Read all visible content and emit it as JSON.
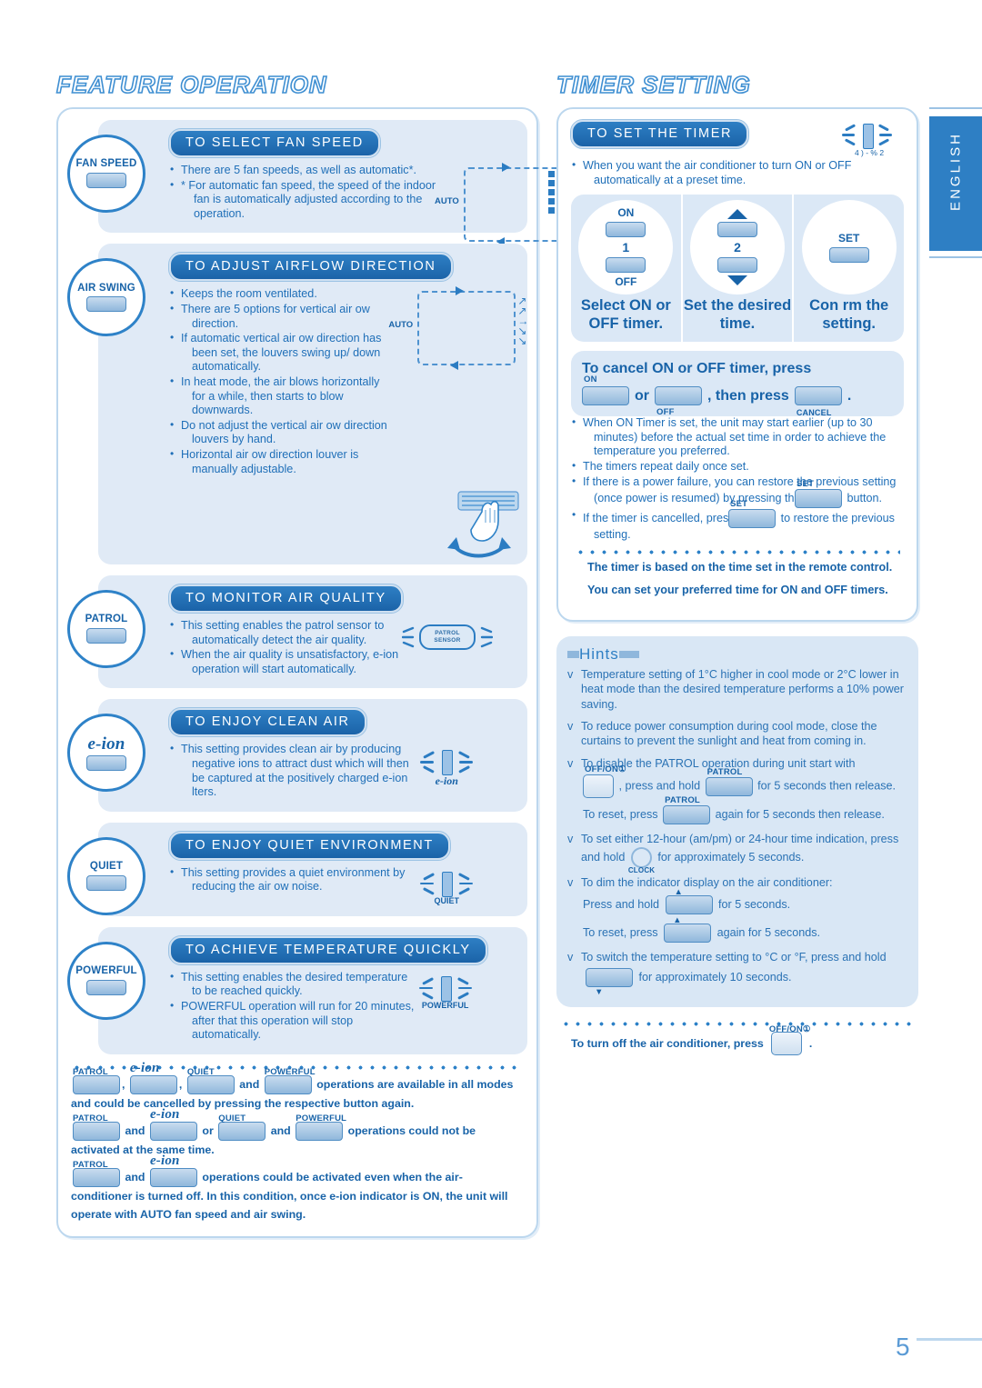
{
  "page": {
    "number": "5",
    "language_tab": "ENGLISH"
  },
  "left": {
    "title": "FEATURE OPERATION",
    "sections": [
      {
        "button_label": "FAN SPEED",
        "heading": "TO SELECT FAN SPEED",
        "bullets": [
          "There are 5 fan speeds, as well as automatic*.",
          "*  For automatic fan speed, the speed of the indoor fan is automatically adjusted according to the operation."
        ],
        "diagram_label": "AUTO"
      },
      {
        "button_label": "AIR SWING",
        "heading": "TO ADJUST AIRFLOW DIRECTION",
        "bullets": [
          "Keeps the room ventilated.",
          "There are 5 options for vertical air ow direction.",
          "If automatic vertical air ow direction has been set, the louvers swing up/ down automatically.",
          "In heat mode, the air blows horizontally for a while, then starts to blow downwards.",
          "Do not adjust the vertical air ow direction louvers by hand.",
          "Horizontal air ow direction louver is manually adjustable."
        ],
        "diagram_label": "AUTO"
      },
      {
        "button_label": "PATROL",
        "heading": "TO MONITOR AIR QUALITY",
        "bullets": [
          "This setting enables the patrol sensor to automatically detect the air quality.",
          "When the air quality is unsatisfactory, e-ion operation will start automatically."
        ],
        "sensor_label_line1": "PATROL",
        "sensor_label_line2": "SENSOR"
      },
      {
        "button_label": "e-ion",
        "heading": "TO ENJOY CLEAN AIR",
        "bullets": [
          "This setting provides clean air by producing negative ions to attract dust which will then be captured at the positively charged e-ion  lters."
        ],
        "indicator_label": "e-ion"
      },
      {
        "button_label": "QUIET",
        "heading": "TO ENJOY QUIET ENVIRONMENT",
        "bullets": [
          "This setting provides a quiet environment by reducing the air ow noise."
        ],
        "indicator_label": "QUIET"
      },
      {
        "button_label": "POWERFUL",
        "heading": "TO ACHIEVE TEMPERATURE QUICKLY",
        "bullets": [
          "This setting enables the desired temperature to be reached quickly.",
          "POWERFUL operation will run for 20 minutes, after that this operation will stop automatically."
        ],
        "indicator_label": "POWERFUL"
      }
    ],
    "notes": {
      "note1_tags": [
        "PATROL",
        "e-ion",
        "QUIET",
        "POWERFUL"
      ],
      "note1_conj": "and",
      "note1_text": "operations are available in all modes and could be cancelled by pressing the respective button again.",
      "note2_tags": [
        "PATROL",
        "e-ion",
        "QUIET",
        "POWERFUL"
      ],
      "note2_joiner1": "and",
      "note2_joiner2": "or",
      "note2_joiner3": "and",
      "note2_text": "operations could not be activated at the same time.",
      "note3_tags": [
        "PATROL",
        "e-ion"
      ],
      "note3_joiner": "and",
      "note3_text": "operations could be activated even when the air-conditioner is turned off. In this condition, once e-ion indicator is ON, the unit will operate with AUTO fan speed and air swing."
    }
  },
  "right": {
    "title": "TIMER SETTING",
    "timer": {
      "heading": "TO SET THE TIMER",
      "indicator_caption": "4 ) - % 2",
      "intro_bullet": "When you want the air conditioner to turn ON or OFF automatically at a preset time.",
      "steps": [
        {
          "num": "1",
          "top_label": "ON",
          "bottom_label": "OFF",
          "caption": "Select ON or OFF timer."
        },
        {
          "num": "2",
          "top_label": "",
          "bottom_label": "",
          "caption": "Set the desired time."
        },
        {
          "num": "",
          "top_label": "SET",
          "bottom_label": "",
          "caption": "Con rm the setting."
        }
      ],
      "cancel_line1": "To cancel ON or OFF timer, press",
      "cancel_on": "ON",
      "cancel_or": "or",
      "cancel_off": "OFF",
      "cancel_then": ", then press",
      "cancel_btn_label": "CANCEL",
      "cancel_period": ".",
      "bullets": [
        "When ON Timer is set, the unit may start earlier (up to 30 minutes) before the actual set time in order to achieve the temperature you preferred.",
        "The timers repeat daily once set."
      ],
      "bullet_power_a": "If there is a power failure, you can restore the previous setting (once power is resumed) by pressing the",
      "bullet_power_btn": "SET",
      "bullet_power_b": "button.",
      "bullet_cancel_a": "If the timer is cancelled, press",
      "bullet_cancel_btn": "SET",
      "bullet_cancel_b": "to restore the previous setting.",
      "note1": "The timer is based on the time set in the remote control.",
      "note2": "You can set your preferred time for ON and OFF timers."
    },
    "hints": {
      "title": "Hints",
      "items": [
        {
          "text": "Temperature setting of 1°C higher in cool mode or 2°C lower in heat mode than the desired temperature performs a 10% power saving."
        },
        {
          "text": "To reduce power consumption during cool mode, close the curtains to prevent the sunlight and heat from coming in."
        },
        {
          "text": "To disable the PATROL operation during unit start with",
          "btn1_label": "OFF/ON",
          "mid1": ", press and hold",
          "btn2_label": "PATROL",
          "mid2": "for 5 seconds then release.",
          "line2_a": "To reset, press",
          "line2_btn": "PATROL",
          "line2_b": "again for 5 seconds then release."
        },
        {
          "text": "To set either 12-hour (am/pm) or 24-hour time indication, press and hold",
          "btn_label": "CLOCK",
          "tail": "for approximately 5 seconds."
        },
        {
          "text": "To dim the indicator display on the air conditioner:",
          "line1_a": "Press and hold",
          "line1_b": "for 5 seconds.",
          "line2_a": "To reset, press",
          "line2_b": "again for 5 seconds."
        },
        {
          "text": "To switch the temperature setting to °C or °F, press and hold",
          "tail": "for approximately 10 seconds."
        }
      ]
    },
    "footer_note": {
      "text": "To turn off the air conditioner, press",
      "btn_label": "OFF/ON",
      "period": "."
    }
  }
}
